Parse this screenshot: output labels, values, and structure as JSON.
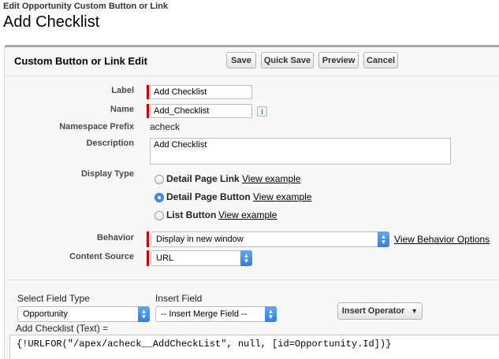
{
  "page": {
    "breadcrumb": "Edit Opportunity Custom Button or Link",
    "title": "Add Checklist"
  },
  "panel": {
    "title": "Custom Button or Link Edit",
    "buttons": {
      "save": "Save",
      "quick_save": "Quick Save",
      "preview": "Preview",
      "cancel": "Cancel"
    }
  },
  "form": {
    "label": {
      "label": "Label",
      "value": "Add Checklist"
    },
    "name": {
      "label": "Name",
      "value": "Add_Checklist",
      "info_icon": "i"
    },
    "namespace": {
      "label": "Namespace Prefix",
      "value": "acheck"
    },
    "description": {
      "label": "Description",
      "value": "Add Checklist"
    },
    "display_type": {
      "label": "Display Type",
      "options": [
        {
          "label": "Detail Page Link",
          "link": "View example",
          "selected": false
        },
        {
          "label": "Detail Page Button",
          "link": "View example",
          "selected": true
        },
        {
          "label": "List Button",
          "link": "View example",
          "selected": false
        }
      ]
    },
    "behavior": {
      "label": "Behavior",
      "value": "Display in new window",
      "link": "View Behavior Options"
    },
    "content_source": {
      "label": "Content Source",
      "value": "URL"
    }
  },
  "formula": {
    "select_field_type": {
      "label": "Select Field Type",
      "value": "Opportunity"
    },
    "insert_field": {
      "label": "Insert Field",
      "value": "-- Insert Merge Field --"
    },
    "insert_operator": {
      "label": "Insert Operator",
      "arrow": "▼"
    },
    "editor_label": "Add Checklist (Text) =",
    "code": "{!URLFOR(\"/apex/acheck__AddCheckList\", null, [id=Opportunity.Id])}"
  },
  "colors": {
    "required": "#cc0000",
    "select_arrow": "#2f7fe3",
    "radio_selected": "#3b8ef2"
  }
}
